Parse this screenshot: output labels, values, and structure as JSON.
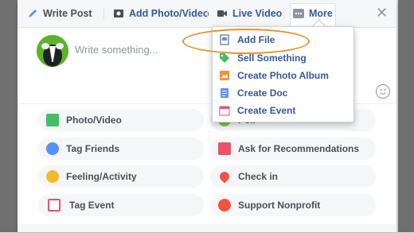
{
  "toolbar": {
    "write_post": "Write Post",
    "add_photo_video": "Add Photo/Video",
    "live_video": "Live Video",
    "more": "More",
    "close": "✕"
  },
  "composer": {
    "placeholder": "Write something..."
  },
  "more_menu": {
    "items": [
      {
        "label": "Add File",
        "icon": "file-icon"
      },
      {
        "label": "Sell Something",
        "icon": "tag-icon"
      },
      {
        "label": "Create Photo Album",
        "icon": "photo-album-icon"
      },
      {
        "label": "Create Doc",
        "icon": "doc-icon"
      },
      {
        "label": "Create Event",
        "icon": "calendar-icon"
      }
    ]
  },
  "actions": {
    "photo_video": "Photo/Video",
    "poll": "Poll",
    "tag_friends": "Tag Friends",
    "ask_recommendations": "Ask for Recommendations",
    "feeling_activity": "Feeling/Activity",
    "check_in": "Check in",
    "tag_event": "Tag Event",
    "support_nonprofit": "Support Nonprofit"
  },
  "colors": {
    "link_blue": "#365899",
    "highlight_orange": "#e6922c",
    "avatar_green": "#5cb32a"
  }
}
